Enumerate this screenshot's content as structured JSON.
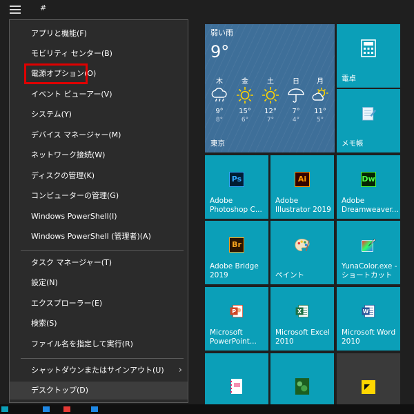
{
  "topbar": {
    "hash": "#"
  },
  "menu": {
    "items": [
      {
        "label": "アプリと機能(F)"
      },
      {
        "label": "モビリティ センター(B)"
      },
      {
        "label": "電源オプション(O)"
      },
      {
        "label": "イベント ビューアー(V)"
      },
      {
        "label": "システム(Y)"
      },
      {
        "label": "デバイス マネージャー(M)"
      },
      {
        "label": "ネットワーク接続(W)"
      },
      {
        "label": "ディスクの管理(K)"
      },
      {
        "label": "コンピューターの管理(G)"
      },
      {
        "label": "Windows PowerShell(I)"
      },
      {
        "label": "Windows PowerShell (管理者)(A)"
      },
      {
        "label": "タスク マネージャー(T)"
      },
      {
        "label": "設定(N)"
      },
      {
        "label": "エクスプローラー(E)"
      },
      {
        "label": "検索(S)"
      },
      {
        "label": "ファイル名を指定して実行(R)"
      },
      {
        "label": "シャットダウンまたはサインアウト(U)"
      },
      {
        "label": "デスクトップ(D)"
      }
    ],
    "chevron": "›",
    "highlight_color": "#e00000"
  },
  "weather": {
    "condition": "弱い雨",
    "temp": "9°",
    "city": "東京",
    "days": [
      {
        "day": "木",
        "hi": "9°",
        "lo": "8°",
        "icon": "rain-cloud-icon"
      },
      {
        "day": "金",
        "hi": "15°",
        "lo": "6°",
        "icon": "sun-icon"
      },
      {
        "day": "土",
        "hi": "12°",
        "lo": "7°",
        "icon": "sun-icon"
      },
      {
        "day": "日",
        "hi": "7°",
        "lo": "4°",
        "icon": "umbrella-icon"
      },
      {
        "day": "月",
        "hi": "11°",
        "lo": "5°",
        "icon": "partly-sunny-icon"
      }
    ]
  },
  "tiles": {
    "calculator": "電卓",
    "memo": "メモ帳",
    "photoshop": {
      "label": "Adobe\nPhotoshop C...",
      "icon_text": "Ps"
    },
    "illustrator": {
      "label": "Adobe\nIllustrator 2019",
      "icon_text": "Ai"
    },
    "dreamweaver": {
      "label": "Adobe\nDreamweaver...",
      "icon_text": "Dw"
    },
    "bridge": {
      "label": "Adobe Bridge\n2019",
      "icon_text": "Br"
    },
    "paint": {
      "label": "ペイント"
    },
    "yunacolor": {
      "label": "YunaColor.exe -\nショートカット"
    },
    "powerpoint": {
      "label": "Microsoft\nPowerPoint..."
    },
    "excel": {
      "label": "Microsoft Excel\n2010"
    },
    "word": {
      "label": "Microsoft Word\n2010"
    }
  },
  "colors": {
    "tile": "#0b9fb8",
    "menu_bg": "#2b2b2b",
    "background": "#1f1f1f"
  }
}
